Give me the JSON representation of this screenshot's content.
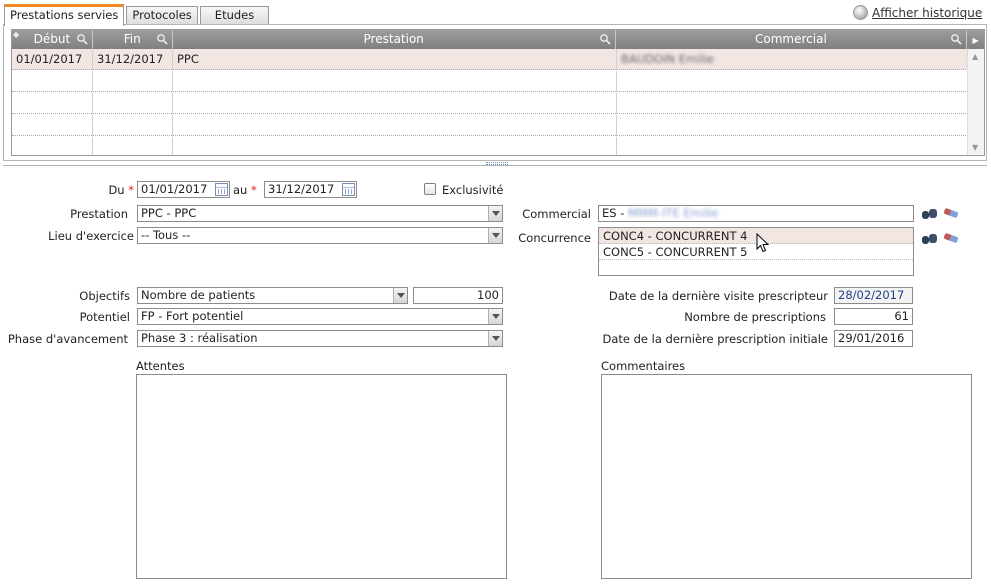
{
  "tabs": [
    {
      "label": "Prestations servies",
      "active": true
    },
    {
      "label": "Protocoles",
      "active": false
    },
    {
      "label": "Etudes",
      "active": false
    }
  ],
  "history_link": "Afficher historique",
  "grid": {
    "columns": [
      "Début",
      "Fin",
      "Prestation",
      "Commercial"
    ],
    "rows": [
      {
        "debut": "01/01/2017",
        "fin": "31/12/2017",
        "prestation": "PPC",
        "commercial": "BAUDOIN Emilie"
      }
    ]
  },
  "form": {
    "du_label": "Du",
    "du_value": "01/01/2017",
    "au_label": "au",
    "au_value": "31/12/2017",
    "exclusivite_label": "Exclusivité",
    "exclusivite_checked": false,
    "prestation_label": "Prestation",
    "prestation_value": "PPC - PPC",
    "lieu_label": "Lieu d'exercice",
    "lieu_value": "-- Tous --",
    "commercial_label": "Commercial",
    "commercial_value": "ES -",
    "commercial_blurred": "MMM-ITE Emilie",
    "concurrence_label": "Concurrence",
    "concurrence_items": [
      "CONC4 - CONCURRENT 4",
      "CONC5 - CONCURRENT 5"
    ],
    "objectifs_label": "Objectifs",
    "objectifs_value": "Nombre de patients",
    "objectifs_number": "100",
    "potentiel_label": "Potentiel",
    "potentiel_value": "FP - Fort potentiel",
    "phase_label": "Phase d'avancement",
    "phase_value": "Phase 3 : réalisation",
    "visite_label": "Date de la dernière visite prescripteur",
    "visite_value": "28/02/2017",
    "nb_prescriptions_label": "Nombre de prescriptions",
    "nb_prescriptions_value": "61",
    "prescription_initiale_label": "Date de la dernière prescription initiale",
    "prescription_initiale_value": "29/01/2016",
    "attentes_label": "Attentes",
    "commentaires_label": "Commentaires"
  },
  "colors": {
    "accent_tab": "#f08a24",
    "selected_row": "#f2e6e2",
    "required": "#d42020",
    "header_bg": "#8f8f8f"
  }
}
